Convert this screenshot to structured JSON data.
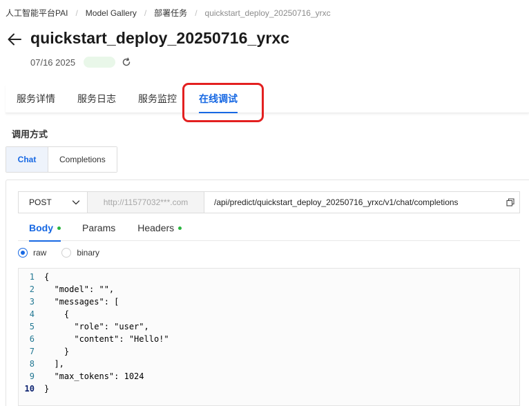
{
  "breadcrumb": [
    "人工智能平台PAI",
    "Model Gallery",
    "部署任务",
    "quickstart_deploy_20250716_yrxc"
  ],
  "breadcrumb_separator": "/",
  "header": {
    "title": "quickstart_deploy_20250716_yrxc",
    "date": "07/16 2025"
  },
  "top_tabs": [
    "服务详情",
    "服务日志",
    "服务监控",
    "在线调试"
  ],
  "active_top_tab": "在线调试",
  "invoke": {
    "section_label": "调用方式",
    "modes": [
      "Chat",
      "Completions"
    ],
    "active_mode": "Chat"
  },
  "request": {
    "method": "POST",
    "host": "http://11577032***.com",
    "path": "/api/predict/quickstart_deploy_20250716_yrxc/v1/chat/completions",
    "sub_tabs": [
      {
        "label": "Body",
        "has_dot": true,
        "active": true
      },
      {
        "label": "Params",
        "has_dot": false,
        "active": false
      },
      {
        "label": "Headers",
        "has_dot": true,
        "active": false
      }
    ],
    "body_types": [
      "raw",
      "binary"
    ],
    "selected_body_type": "raw"
  },
  "code": {
    "lines": [
      {
        "n": "1",
        "text": "{"
      },
      {
        "n": "2",
        "text": "  \"model\": \"\","
      },
      {
        "n": "3",
        "text": "  \"messages\": ["
      },
      {
        "n": "4",
        "text": "    {"
      },
      {
        "n": "5",
        "text": "      \"role\": \"user\","
      },
      {
        "n": "6",
        "text": "      \"content\": \"Hello!\""
      },
      {
        "n": "7",
        "text": "    }"
      },
      {
        "n": "8",
        "text": "  ],"
      },
      {
        "n": "9",
        "text": "  \"max_tokens\": 1024"
      },
      {
        "n": "10",
        "text": "}"
      }
    ],
    "current_line": "10"
  },
  "colors": {
    "accent": "#1768e3",
    "highlight": "#e32020",
    "dot": "#2ab53f"
  }
}
